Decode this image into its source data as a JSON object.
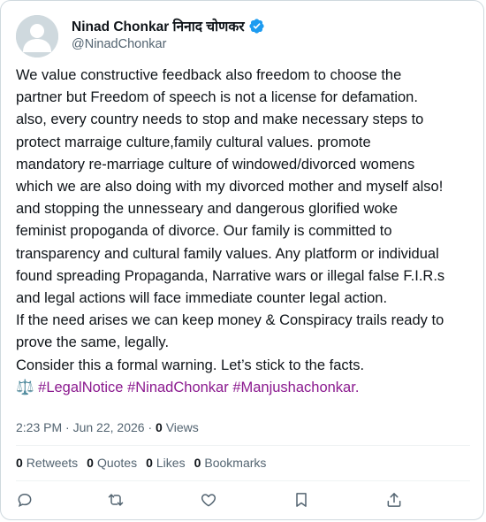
{
  "author": {
    "display_name": "Ninad Chonkar निनाद चोणकर",
    "handle": "@NinadChonkar",
    "verified_icon": "verified-badge-icon",
    "verified_color": "#1d9bf0"
  },
  "tweet": {
    "lines": [
      "We value constructive feedback also freedom to choose the",
      "partner but Freedom of speech is not a license for defamation.",
      "also, every country needs to stop and make necessary steps to",
      "protect marraige culture,family cultural values. promote",
      "mandatory re-marriage culture of windowed/divorced womens",
      "which we are also doing with my divorced mother and myself also!",
      "and stopping the unnesseary and dangerous glorified woke",
      "feminist propoganda of divorce. Our family is committed to",
      "transparency and cultural family values. Any platform or individual",
      "found spreading Propaganda, Narrative wars or illegal false F.I.R.s",
      "and legal actions will face immediate counter legal action.",
      "If the need arises we can keep money & Conspiracy trails ready to",
      "prove the same, legally.",
      "Consider this a formal warning. Let’s stick to the facts."
    ],
    "emoji": "⚖️",
    "hashtags": [
      "#LegalNotice",
      "#NinadChonkar",
      "#Manjushachonkar."
    ],
    "hashtag_color": "#8b1a8f"
  },
  "meta": {
    "time": "2:23 PM",
    "separator": "·",
    "date": "Jun 22, 2026",
    "views_count": "0",
    "views_label": "Views"
  },
  "stats": [
    {
      "count": "0",
      "label": "Retweets"
    },
    {
      "count": "0",
      "label": "Quotes"
    },
    {
      "count": "0",
      "label": "Likes"
    },
    {
      "count": "0",
      "label": "Bookmarks"
    }
  ],
  "actions": [
    {
      "name": "reply",
      "icon": "reply-icon"
    },
    {
      "name": "retweet",
      "icon": "retweet-icon"
    },
    {
      "name": "like",
      "icon": "like-icon"
    },
    {
      "name": "bookmark",
      "icon": "bookmark-icon"
    },
    {
      "name": "share",
      "icon": "share-icon"
    }
  ]
}
